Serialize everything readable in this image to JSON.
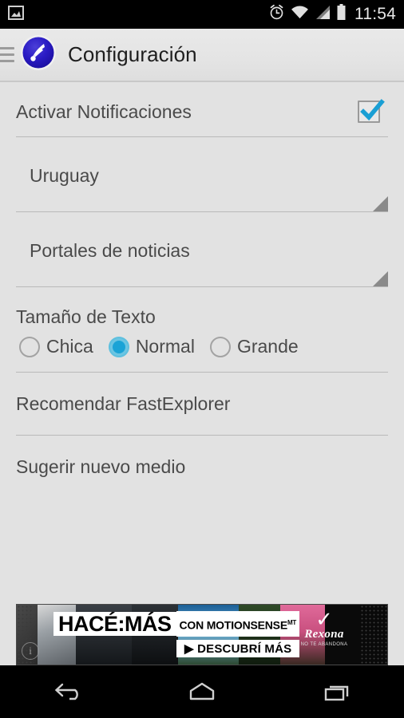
{
  "status_bar": {
    "notification_icon": "image-notification-icon",
    "icons": [
      "alarm-clock-icon",
      "wifi-icon",
      "cellular-signal-icon",
      "battery-icon"
    ],
    "time": "11:54"
  },
  "action_bar": {
    "menu_icon": "hamburger-menu-icon",
    "app_logo": "fastexplorer-app-logo",
    "title": "Configuración"
  },
  "settings": {
    "notifications": {
      "label": "Activar Notificaciones",
      "checked": true,
      "checkbox_color": "#1a9fd4"
    },
    "country_spinner": {
      "value": "Uruguay",
      "arrow_icon": "spinner-dropdown-arrow"
    },
    "category_spinner": {
      "value": "Portales de noticias",
      "arrow_icon": "spinner-dropdown-arrow"
    },
    "text_size": {
      "title": "Tamaño de Texto",
      "options": [
        {
          "label": "Chica",
          "selected": false
        },
        {
          "label": "Normal",
          "selected": true
        },
        {
          "label": "Grande",
          "selected": false
        }
      ],
      "selected_color": "#1aa3d6"
    },
    "actions": [
      {
        "label": "Recomendar FastExplorer"
      },
      {
        "label": "Sugerir nuevo medio"
      }
    ]
  },
  "ad": {
    "headline": "HACÉ:MÁS",
    "subhead": "CON MOTIONSENSE",
    "subhead_sup": "MT",
    "cta": "▶ DESCUBRÍ MÁS",
    "brand_check": "✓",
    "brand": "Rexona",
    "brand_tagline": "NO TE ABANDONA",
    "info_icon": "ad-choices-info-icon"
  },
  "nav_bar": {
    "buttons": [
      {
        "name": "back-button",
        "icon": "back-arrow-icon"
      },
      {
        "name": "home-button",
        "icon": "home-icon"
      },
      {
        "name": "recents-button",
        "icon": "recent-apps-icon"
      }
    ]
  },
  "theme": {
    "background": "#e2e2e2",
    "text": "#4a4a4a",
    "divider": "#b9b9b9",
    "accent": "#1a9fd4"
  }
}
